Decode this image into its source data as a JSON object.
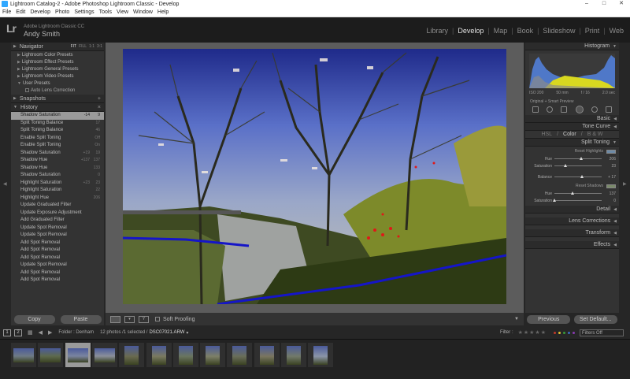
{
  "window": {
    "title": "Lightroom Catalog-2 - Adobe Photoshop Lightroom Classic - Develop",
    "controls": [
      "–",
      "□",
      "✕"
    ]
  },
  "menu": [
    "File",
    "Edit",
    "Develop",
    "Photo",
    "Settings",
    "Tools",
    "View",
    "Window",
    "Help"
  ],
  "identity": {
    "logo": "Lr",
    "product": "Adobe Lightroom Classic CC",
    "user": "Andy Smith"
  },
  "modules": [
    "Library",
    "Develop",
    "Map",
    "Book",
    "Slideshow",
    "Print",
    "Web"
  ],
  "active_module": "Develop",
  "navigator": {
    "title": "Navigator",
    "options": [
      "FIT",
      "FILL",
      "1:1",
      "3:1"
    ]
  },
  "presets": [
    "Lightroom Color Presets",
    "Lightroom Effect Presets",
    "Lightroom General Presets",
    "Lightroom Video Presets",
    "User Presets"
  ],
  "preset_sub": "Auto Lens Correction",
  "snapshots": {
    "title": "Snapshots",
    "action": "+"
  },
  "history": {
    "title": "History",
    "action": "×",
    "items": [
      {
        "label": "Shadow Saturation",
        "v1": "-14",
        "v2": "9",
        "selected": true
      },
      {
        "label": "Split Toning Balance",
        "v1": "",
        "v2": "17"
      },
      {
        "label": "Split Toning Balance",
        "v1": "",
        "v2": "46"
      },
      {
        "label": "Enable Split Toning",
        "v1": "",
        "v2": "Off"
      },
      {
        "label": "Enable Split Toning",
        "v1": "",
        "v2": "On"
      },
      {
        "label": "Shadow Saturation",
        "v1": "+19",
        "v2": "19"
      },
      {
        "label": "Shadow Hue",
        "v1": "+137",
        "v2": "137"
      },
      {
        "label": "Shadow Hue",
        "v1": "",
        "v2": "133"
      },
      {
        "label": "Shadow Saturation",
        "v1": "",
        "v2": "0"
      },
      {
        "label": "Highlight Saturation",
        "v1": "+23",
        "v2": "23"
      },
      {
        "label": "Highlight Saturation",
        "v1": "",
        "v2": "22"
      },
      {
        "label": "Highlight Hue",
        "v1": "",
        "v2": "206"
      },
      {
        "label": "Update Graduated Filter",
        "v1": "",
        "v2": ""
      },
      {
        "label": "Update Exposure Adjustment",
        "v1": "",
        "v2": ""
      },
      {
        "label": "Add Graduated Filter",
        "v1": "",
        "v2": ""
      },
      {
        "label": "Update Spot Removal",
        "v1": "",
        "v2": ""
      },
      {
        "label": "Update Spot Removal",
        "v1": "",
        "v2": ""
      },
      {
        "label": "Add Spot Removal",
        "v1": "",
        "v2": ""
      },
      {
        "label": "Add Spot Removal",
        "v1": "",
        "v2": ""
      },
      {
        "label": "Add Spot Removal",
        "v1": "",
        "v2": ""
      },
      {
        "label": "Update Spot Removal",
        "v1": "",
        "v2": ""
      },
      {
        "label": "Add Spot Removal",
        "v1": "",
        "v2": ""
      },
      {
        "label": "Add Spot Removal",
        "v1": "",
        "v2": ""
      }
    ]
  },
  "left_buttons": {
    "copy": "Copy",
    "paste": "Paste"
  },
  "toolbar": {
    "soft_proofing": "Soft Proofing",
    "icons": [
      "loupe-view-icon",
      "compare-view-icon",
      "before-after-icon"
    ]
  },
  "histogram": {
    "title": "Histogram",
    "info": [
      "ISO 200",
      "50 mm",
      "f / 16",
      "2.0 sec"
    ],
    "original": "Original + Smart Preview"
  },
  "right_sections": {
    "basic": "Basic",
    "tone_curve": "Tone Curve",
    "hsl": [
      "HSL",
      "Color",
      "B & W"
    ],
    "split_toning": "Split Toning",
    "detail": "Detail",
    "lens": "Lens Corrections",
    "transform": "Transform",
    "effects": "Effects"
  },
  "split_toning": {
    "highlights_label": "Reset Highlights",
    "highlights_swatch": "#6d8aa6",
    "highlight_hue": {
      "label": "Hue",
      "value": "206",
      "fraction": 0.57
    },
    "highlight_sat": {
      "label": "Saturation",
      "value": "23",
      "fraction": 0.23
    },
    "balance": {
      "label": "Balance",
      "value": "+ 17",
      "fraction": 0.58
    },
    "shadows_label": "Reset Shadows",
    "shadows_swatch": "#7a8a6a",
    "shadow_hue": {
      "label": "Hue",
      "value": "137",
      "fraction": 0.38
    },
    "shadow_sat": {
      "label": "Saturation",
      "value": "0",
      "fraction": 0.0
    }
  },
  "right_buttons": {
    "previous": "Previous",
    "reset": "Set Default..."
  },
  "filmbar": {
    "screen1": "1",
    "screen2": "2",
    "folder": "Folder : Denham",
    "count": "12 photos /1 selected /",
    "file": "DSC07021.ARW",
    "filter_label": "Filter :",
    "filter_value": "Filters Off",
    "colors": [
      "#c0392b",
      "#e0c030",
      "#3a9a3a",
      "#3a6ac0",
      "#8a3ab0"
    ]
  },
  "filmstrip": {
    "count": 12,
    "selected_index": 2,
    "landscape": [
      0,
      1,
      2,
      3
    ]
  }
}
